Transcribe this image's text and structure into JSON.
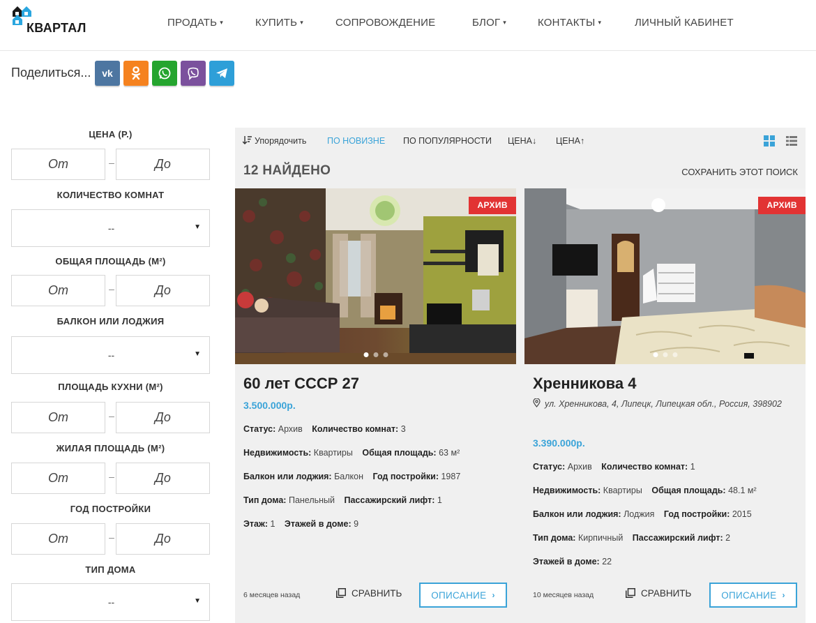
{
  "header": {
    "logo_text": "КВАРТАЛ",
    "nav": [
      {
        "label": "ПРОДАТЬ",
        "has_dropdown": true
      },
      {
        "label": "КУПИТЬ",
        "has_dropdown": true
      },
      {
        "label": "СОПРОВОЖДЕНИЕ",
        "has_dropdown": false
      },
      {
        "label": "БЛОГ",
        "has_dropdown": true
      },
      {
        "label": "КОНТАКТЫ",
        "has_dropdown": true
      },
      {
        "label": "ЛИЧНЫЙ КАБИНЕТ",
        "has_dropdown": false
      }
    ],
    "caret": "▾"
  },
  "share": {
    "label": "Поделиться...",
    "buttons": [
      {
        "name": "vk",
        "icon": "vk-icon",
        "glyph": "vk",
        "color": "#4d76a1"
      },
      {
        "name": "odnoklassniki",
        "icon": "ok-icon",
        "glyph": "ok",
        "color": "#f5821f"
      },
      {
        "name": "whatsapp",
        "icon": "whatsapp-icon",
        "glyph": "wa",
        "color": "#25a52f"
      },
      {
        "name": "viber",
        "icon": "viber-icon",
        "glyph": "vb",
        "color": "#7b519d"
      },
      {
        "name": "telegram",
        "icon": "telegram-icon",
        "glyph": "tg",
        "color": "#2e9fd8"
      }
    ]
  },
  "filters": {
    "price": {
      "label": "ЦЕНА (Р.)",
      "from": "От",
      "to": "До"
    },
    "rooms": {
      "label": "КОЛИЧЕСТВО КОМНАТ",
      "value": "--"
    },
    "total_area": {
      "label": "ОБЩАЯ ПЛОЩАДЬ (М²)",
      "from": "От",
      "to": "До"
    },
    "balcony": {
      "label": "БАЛКОН ИЛИ ЛОДЖИЯ",
      "value": "--"
    },
    "kitchen_area": {
      "label": "ПЛОЩАДЬ КУХНИ (М²)",
      "from": "От",
      "to": "До"
    },
    "living_area": {
      "label": "ЖИЛАЯ ПЛОЩАДЬ (М²)",
      "from": "От",
      "to": "До"
    },
    "year": {
      "label": "ГОД ПОСТРОЙКИ",
      "from": "От",
      "to": "До"
    },
    "house_type": {
      "label": "ТИП ДОМА",
      "value": "--"
    },
    "dash": "–",
    "select_arrow": "▼"
  },
  "results": {
    "sort_label": "Упорядочить",
    "sort_options": [
      {
        "label": "ПО НОВИЗНЕ",
        "active": true
      },
      {
        "label": "ПО ПОПУЛЯРНОСТИ",
        "active": false
      },
      {
        "label": "ЦЕНА↓",
        "active": false
      },
      {
        "label": "ЦЕНА↑",
        "active": false
      }
    ],
    "view_modes": [
      "grid-view-icon",
      "list-view-icon"
    ],
    "active_view": "grid",
    "found_text": "12 НАЙДЕНО",
    "save_search": "СОХРАНИТЬ ЭТОТ ПОИСК"
  },
  "listings": [
    {
      "badge": "АРХИВ",
      "title": "60 лет СССР 27",
      "address": "",
      "price": "3.500.000р.",
      "props": [
        [
          {
            "k": "Статус:",
            "v": "Архив"
          },
          {
            "k": "Количество комнат:",
            "v": "3"
          }
        ],
        [
          {
            "k": "Недвижимость:",
            "v": "Квартиры"
          },
          {
            "k": "Общая площадь:",
            "v": "63 м²"
          }
        ],
        [
          {
            "k": "Балкон или лоджия:",
            "v": "Балкон"
          },
          {
            "k": "Год постройки:",
            "v": "1987"
          }
        ],
        [
          {
            "k": "Тип дома:",
            "v": "Панельный"
          },
          {
            "k": "Пассажирский лифт:",
            "v": "1"
          }
        ],
        [
          {
            "k": "Этаж:",
            "v": "1"
          },
          {
            "k": "Этажей в доме:",
            "v": "9"
          }
        ]
      ],
      "time": "6 месяцев назад",
      "compare": "СРАВНИТЬ",
      "details": "ОПИСАНИЕ",
      "slides": 3,
      "active_slide": 0
    },
    {
      "badge": "АРХИВ",
      "title": "Хренникова 4",
      "address": "ул. Хренникова, 4, Липецк, Липецкая обл., Россия, 398902",
      "price": "3.390.000р.",
      "props": [
        [
          {
            "k": "Статус:",
            "v": "Архив"
          },
          {
            "k": "Количество комнат:",
            "v": "1"
          }
        ],
        [
          {
            "k": "Недвижимость:",
            "v": "Квартиры"
          },
          {
            "k": "Общая площадь:",
            "v": "48.1 м²"
          }
        ],
        [
          {
            "k": "Балкон или лоджия:",
            "v": "Лоджия"
          },
          {
            "k": "Год постройки:",
            "v": "2015"
          }
        ],
        [
          {
            "k": "Тип дома:",
            "v": "Кирпичный"
          },
          {
            "k": "Пассажирский лифт:",
            "v": "2"
          }
        ],
        [
          {
            "k": "Этажей в доме:",
            "v": "22"
          }
        ]
      ],
      "time": "10 месяцев назад",
      "compare": "СРАВНИТЬ",
      "details": "ОПИСАНИЕ",
      "slides": 3,
      "active_slide": 0
    }
  ],
  "colors": {
    "accent": "#3aa3d8",
    "badge": "#e23333",
    "panel_bg": "#f0f0f0"
  }
}
